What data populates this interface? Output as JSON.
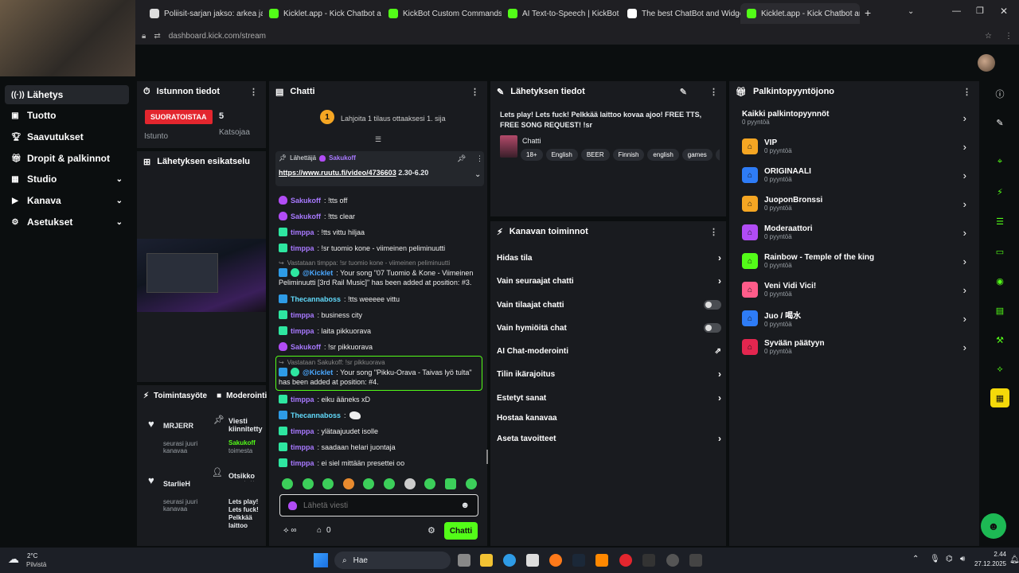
{
  "browser": {
    "tabs": [
      {
        "label": "Poliisit-sarjan jakso: arkea ja tel"
      },
      {
        "label": "Kicklet.app - Kick Chatbot a"
      },
      {
        "label": "KickBot Custom Commands"
      },
      {
        "label": "AI Text-to-Speech | KickBot"
      },
      {
        "label": "The best ChatBot and Widgets"
      },
      {
        "label": "Kicklet.app - Kick Chatbot and C"
      }
    ],
    "url": "dashboard.kick.com/stream"
  },
  "nav": {
    "items": [
      {
        "label": "Lähetys"
      },
      {
        "label": "Tuotto"
      },
      {
        "label": "Saavutukset"
      },
      {
        "label": "Dropit & palkinnot"
      },
      {
        "label": "Studio"
      },
      {
        "label": "Kanava"
      },
      {
        "label": "Asetukset"
      }
    ]
  },
  "session": {
    "title": "Istunnon tiedot",
    "live_badge": "SUORATOISTAA",
    "live_label": "Istunto",
    "viewers": "5",
    "viewers_label": "Katsojaa",
    "preview_title": "Lähetyksen esikatselu"
  },
  "activity": {
    "title": "Toimintasyöte",
    "mod_title": "Moderointi",
    "feed": [
      {
        "name": "MRJERR",
        "sub": "seurasi juuri kanavaa"
      },
      {
        "name": "StarlieH",
        "sub": "seurasi juuri kanavaa"
      }
    ],
    "mod": [
      {
        "title": "Viesti kiinnitetty",
        "user": "Sakukoff",
        "sub": "toimesta"
      },
      {
        "title": "Otsikko muutettu",
        "user": "Lets play! Lets fuck! Pelkkää laittoo",
        "sub": ""
      }
    ]
  },
  "chat": {
    "title": "Chatti",
    "goal_number": "1",
    "goal_text": "Lahjoita 1 tilaus ottaaksesi 1. sija",
    "pinned_by": "Lähettäjä",
    "pinned_user": "Sakukoff",
    "pinned_link": "https://www.ruutu.fi/video/4736603",
    "pinned_suffix": " 2.30-6.20",
    "messages": [
      {
        "user": "Sakukoff",
        "text": ": !tts off"
      },
      {
        "user": "Sakukoff",
        "text": ": !tts clear"
      },
      {
        "user": "timppa",
        "text": ": !tts vittu hiljaa"
      },
      {
        "user": "timppa",
        "text": ": !sr tuomio kone - viimeinen peliminuutti"
      },
      {
        "reply": "Vastataan timppa: !sr tuomio kone - viimeinen peliminuutti"
      },
      {
        "user": "@Kicklet",
        "text": ": Your song \"07 Tuomio & Kone - Viimeinen"
      },
      {
        "text": "Peliminuutti [3rd Rail Music]\" has been added at position: #3."
      },
      {
        "user": "Thecannaboss",
        "text": ": !tts weeeee vittu"
      },
      {
        "user": "timppa",
        "text": ": business city"
      },
      {
        "user": "timppa",
        "text": ": laita pikkuorava"
      },
      {
        "user": "Sakukoff",
        "text": ": !sr pikkuorava"
      },
      {
        "reply": "Vastataan Sakukoff: !sr pikkuorava"
      },
      {
        "user": "@Kicklet",
        "text": ": Your song \"Pikku-Orava - Taivas lyö tulta\""
      },
      {
        "text": "has been added at position: #4."
      },
      {
        "user": "timppa",
        "text": ": eiku ääneks xD"
      },
      {
        "user": "Thecannaboss",
        "text": ":"
      },
      {
        "user": "timppa",
        "text": ": ylätaajuudet isolle"
      },
      {
        "user": "timppa",
        "text": ": saadaan helari juontaja"
      },
      {
        "user": "timppa",
        "text": ": ei siel mittään presettei oo"
      }
    ],
    "input_placeholder": "Lähetä viesti",
    "points": "0",
    "send_label": "Chatti"
  },
  "stream_info": {
    "title": "Lähetyksen tiedot",
    "stream_title": "Lets play! Lets fuck! Pelkkää laittoo kovaa ajoo! FREE TTS, FREE SONG REQUEST! !sr",
    "category": "Chatti",
    "tags": [
      "18+",
      "English",
      "BEER",
      "Finnish",
      "english",
      "games",
      "ja"
    ]
  },
  "channel_actions": {
    "title": "Kanavan toiminnot",
    "items": [
      {
        "label": "Hidas tila"
      },
      {
        "label": "Vain seuraajat chatti"
      },
      {
        "label": "Vain tilaajat chatti"
      },
      {
        "label": "Vain hymiöitä chat"
      },
      {
        "label": "AI Chat-moderointi"
      },
      {
        "label": "Tilin ikärajoitus"
      },
      {
        "label": "Estetyt sanat"
      },
      {
        "label": "Hostaa kanavaa"
      },
      {
        "label": "Aseta tavoitteet"
      }
    ]
  },
  "rewards": {
    "title": "Palkintopyyntöjono",
    "all_label": "Kaikki palkintopyynnöt",
    "all_count": "0 pyyntöä",
    "items": [
      {
        "name": "VIP",
        "count": "0 pyyntöä",
        "color": "#f5a623"
      },
      {
        "name": "ORIGINAALI",
        "count": "0 pyyntöä",
        "color": "#2e7cf6"
      },
      {
        "name": "JuoponBronssi",
        "count": "0 pyyntöä",
        "color": "#f5a623"
      },
      {
        "name": "Moderaattori",
        "count": "0 pyyntöä",
        "color": "#b14cf5"
      },
      {
        "name": "Rainbow - Temple of the king",
        "count": "0 pyyntöä",
        "color": "#53fc18"
      },
      {
        "name": "Veni Vidi Vici!",
        "count": "0 pyyntöä",
        "color": "#ff5c8a"
      },
      {
        "name": "Juo / 喝水",
        "count": "0 pyyntöä",
        "color": "#2e7cf6"
      },
      {
        "name": "Syvään päätyyn",
        "count": "0 pyyntöä",
        "color": "#e3264f"
      }
    ]
  },
  "taskbar": {
    "weather_temp": "2°C",
    "weather_text": "Pilvistä",
    "search_label": "Hae",
    "time": "2.44",
    "date": "27.12.2025"
  },
  "colors": {
    "accent": "#53fc18",
    "live": "#e3262e",
    "panel": "#191b1f"
  }
}
